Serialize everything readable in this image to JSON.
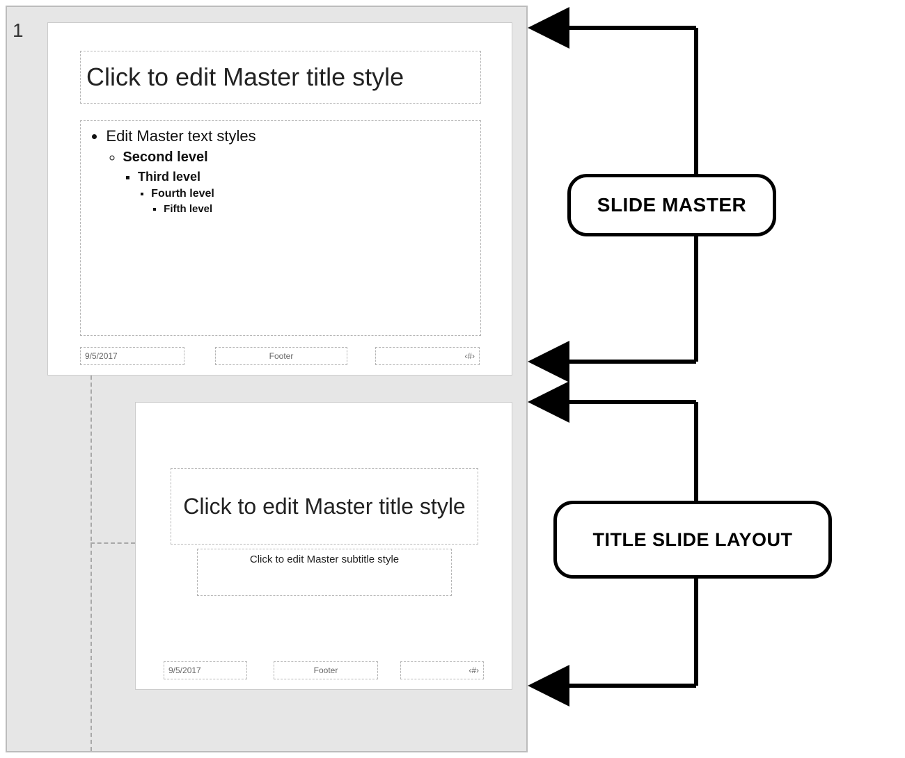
{
  "slide_number": "1",
  "master": {
    "title_placeholder": "Click to edit Master title style",
    "bullets": {
      "l1": "Edit Master text styles",
      "l2": "Second level",
      "l3": "Third level",
      "l4": "Fourth level",
      "l5": "Fifth level"
    },
    "date": "9/5/2017",
    "footer": "Footer",
    "page_num": "‹#›"
  },
  "layout": {
    "title_placeholder": "Click to edit Master title style",
    "subtitle_placeholder": "Click to edit Master subtitle style",
    "date": "9/5/2017",
    "footer": "Footer",
    "page_num": "‹#›"
  },
  "callouts": {
    "master": "SLIDE MASTER",
    "layout": "TITLE SLIDE LAYOUT"
  }
}
